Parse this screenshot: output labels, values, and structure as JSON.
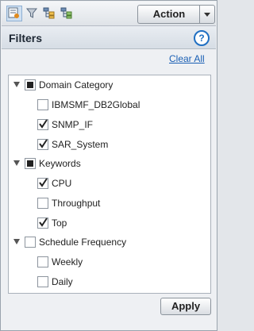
{
  "toolbar": {
    "icons": [
      "filter-panel-icon",
      "funnel-icon",
      "hierarchy-icon",
      "hierarchy-alt-icon"
    ],
    "action_label": "Action"
  },
  "filters": {
    "title": "Filters",
    "help_glyph": "?",
    "clear_all": "Clear All",
    "groups": [
      {
        "label": "Domain Category",
        "state": "partial",
        "items": [
          {
            "label": "IBMSMF_DB2Global",
            "checked": false
          },
          {
            "label": "SNMP_IF",
            "checked": true
          },
          {
            "label": "SAR_System",
            "checked": true
          }
        ]
      },
      {
        "label": "Keywords",
        "state": "partial",
        "items": [
          {
            "label": "CPU",
            "checked": true
          },
          {
            "label": "Throughput",
            "checked": false
          },
          {
            "label": "Top",
            "checked": true
          }
        ]
      },
      {
        "label": "Schedule Frequency",
        "state": "unchecked",
        "items": [
          {
            "label": "Weekly",
            "checked": false
          },
          {
            "label": "Daily",
            "checked": false
          }
        ]
      }
    ],
    "apply_label": "Apply"
  },
  "colors": {
    "accent": "#1f6fc2",
    "link": "#1a5fb4"
  }
}
